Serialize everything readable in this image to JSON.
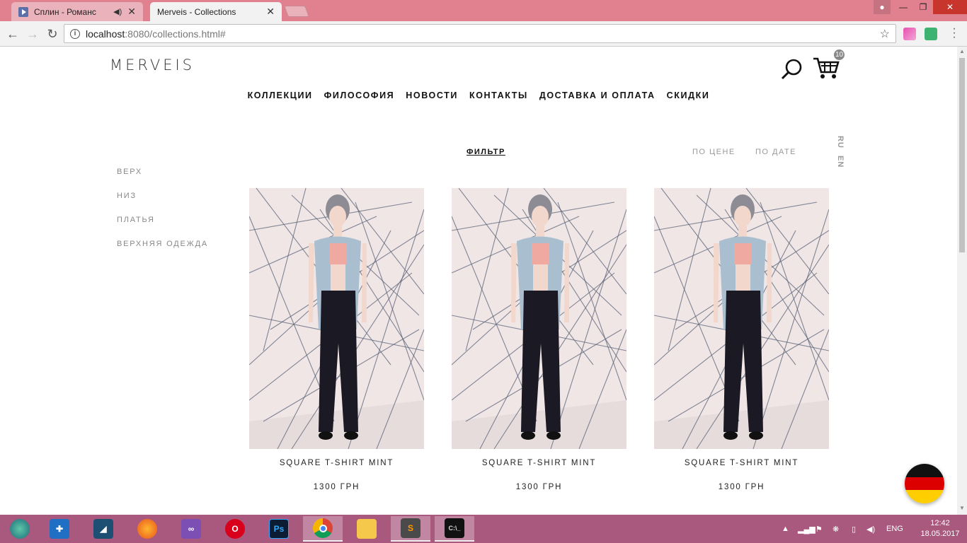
{
  "browser": {
    "tabs": [
      {
        "title": "Сплин - Романс",
        "active": false
      },
      {
        "title": "Merveis - Collections",
        "active": true
      }
    ],
    "url_host": "localhost",
    "url_path": ":8080/collections.html#"
  },
  "header": {
    "logo": "MERVEIS",
    "cart_count": "10"
  },
  "nav": [
    "КОЛЛЕКЦИИ",
    "ФИЛОСОФИЯ",
    "НОВОСТИ",
    "КОНТАКТЫ",
    "ДОСТАВКА И ОПЛАТА",
    "СКИДКИ"
  ],
  "toolbar": {
    "filter_label": "ФИЛЬТР",
    "sort_price": "ПО ЦЕНЕ",
    "sort_date": "ПО ДАТЕ",
    "lang_ru": "RU",
    "lang_en": "EN"
  },
  "categories": [
    "ВЕРХ",
    "НИЗ",
    "ПЛАТЬЯ",
    "ВЕРХНЯЯ ОДЕЖДА"
  ],
  "products": [
    {
      "name": "SQUARE T-SHIRT MINT",
      "price": "1300 ГРН"
    },
    {
      "name": "SQUARE T-SHIRT MINT",
      "price": "1300 ГРН"
    },
    {
      "name": "SQUARE T-SHIRT MINT",
      "price": "1300 ГРН"
    }
  ],
  "taskbar": {
    "lang": "ENG",
    "time": "12:42",
    "date": "18.05.2017"
  },
  "colors": {
    "tabbar": "#e1808f",
    "taskbar": "#a9587e",
    "vest": "#a9bfd0",
    "trousers": "#1b1a24"
  }
}
